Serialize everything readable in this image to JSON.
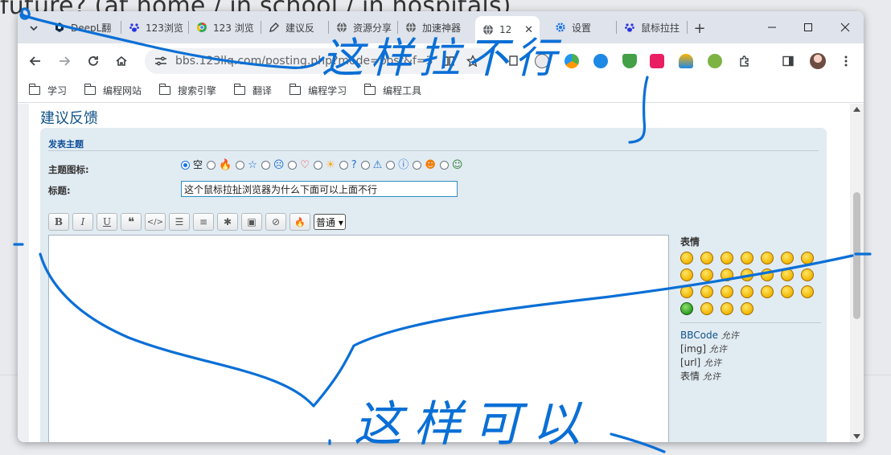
{
  "background": {
    "text": "future? (at home / in school / in hospitals)"
  },
  "tabs": [
    {
      "label": "DeepL翻",
      "icon": "deepl-icon"
    },
    {
      "label": "123浏览",
      "icon": "baidu-paw-icon"
    },
    {
      "label": "123 浏览",
      "icon": "chrome-webstore-icon"
    },
    {
      "label": "建议反",
      "icon": "pen-icon"
    },
    {
      "label": "资源分享",
      "icon": "globe-icon"
    },
    {
      "label": "加速神器",
      "icon": "globe-icon"
    },
    {
      "label": "12",
      "icon": "globe-icon",
      "active": true
    },
    {
      "label": "设置",
      "icon": "gear-icon"
    },
    {
      "label": "鼠标拉拄",
      "icon": "baidu-paw-icon"
    }
  ],
  "toolbar": {
    "url": "bbs.123llq.com/posting.php?mode=post&f=3"
  },
  "bookmarks": [
    "学习",
    "编程网站",
    "搜索引擎",
    "翻译",
    "编程学习",
    "编程工具"
  ],
  "page": {
    "heading": "建议反馈",
    "panel_title": "发表主题",
    "topic_icon_label": "主题图标:",
    "title_label": "标题:",
    "icon_none": "空",
    "topic_icons": [
      "🔥",
      "☆",
      "☹",
      "♡",
      "☀",
      "?",
      "⚠",
      "ⓘ",
      "☻",
      "☺"
    ],
    "title_value": "这个鼠标拉扯浏览器为什么下面可以上面不行",
    "format_buttons": [
      "B",
      "I",
      "U",
      "❝",
      "</>",
      "☰",
      "≡",
      "✱",
      "▣",
      "⊘",
      "🔥"
    ],
    "size_select": "普通 ▾",
    "smiley_title": "表情",
    "smiley_count": 25,
    "permissions": [
      {
        "name": "BBCode",
        "value": "允许"
      },
      {
        "name": "[img]",
        "value": "允许"
      },
      {
        "name": "[url]",
        "value": "允许"
      },
      {
        "name": "表情",
        "value": "允许"
      }
    ]
  },
  "annotations": {
    "top": "这样拉不行",
    "bottom": "这样可以"
  },
  "colors": {
    "accent": "#1a73e8",
    "ink": "#0a6fd6",
    "link": "#105289",
    "panel": "#e1ebf2"
  }
}
